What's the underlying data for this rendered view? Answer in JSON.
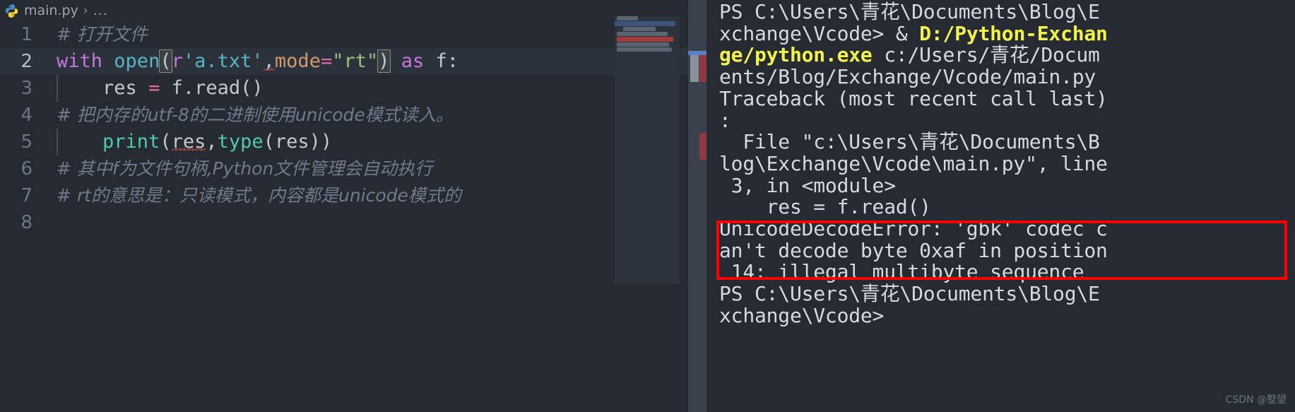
{
  "window": {
    "app": "vscode-editor-with-terminal"
  },
  "breadcrumb": {
    "file_icon": "python-file-icon",
    "file": "main.py",
    "separator": "›",
    "dots": "..."
  },
  "editor": {
    "active_line": 2,
    "gutter": [
      "1",
      "2",
      "3",
      "4",
      "5",
      "6",
      "7",
      "8"
    ],
    "lines": [
      {
        "number": "1",
        "type": "comment",
        "text": "# 打开文件"
      },
      {
        "number": "2",
        "type": "code",
        "tokens": [
          {
            "t": "with",
            "c": "keyword"
          },
          {
            "t": " ",
            "c": "plain"
          },
          {
            "t": "open",
            "c": "function"
          },
          {
            "t": "(",
            "c": "bracket-match"
          },
          {
            "t": "r",
            "c": "raw-prefix"
          },
          {
            "t": "'a.txt'",
            "c": "string"
          },
          {
            "t": ",",
            "c": "plain-squiggle"
          },
          {
            "t": "mode",
            "c": "param"
          },
          {
            "t": "=",
            "c": "operator"
          },
          {
            "t": "\"rt\"",
            "c": "string"
          },
          {
            "t": ")",
            "c": "bracket-match"
          },
          {
            "t": " ",
            "c": "plain"
          },
          {
            "t": "as",
            "c": "keyword"
          },
          {
            "t": " f:",
            "c": "plain"
          }
        ],
        "plain": "with open(r'a.txt',mode=\"rt\") as f:"
      },
      {
        "number": "3",
        "type": "code",
        "tokens": [
          {
            "t": "    ",
            "c": "plain"
          },
          {
            "t": "res",
            "c": "plain"
          },
          {
            "t": " ",
            "c": "plain"
          },
          {
            "t": "=",
            "c": "equals"
          },
          {
            "t": " ",
            "c": "plain"
          },
          {
            "t": "f.read()",
            "c": "plain"
          }
        ],
        "plain": "    res = f.read()"
      },
      {
        "number": "4",
        "type": "comment",
        "text": "# 把内存的utf-8的二进制使用unicode模式读入。"
      },
      {
        "number": "5",
        "type": "code",
        "tokens": [
          {
            "t": "    ",
            "c": "plain"
          },
          {
            "t": "print",
            "c": "builtin"
          },
          {
            "t": "(",
            "c": "plain"
          },
          {
            "t": "res",
            "c": "plain-squiggle"
          },
          {
            "t": ",",
            "c": "plain"
          },
          {
            "t": "type",
            "c": "builtin"
          },
          {
            "t": "(res))",
            "c": "plain"
          }
        ],
        "plain": "    print(res,type(res))"
      },
      {
        "number": "6",
        "type": "comment",
        "text": "# 其中f为文件句柄,Python文件管理会自动执行"
      },
      {
        "number": "7",
        "type": "comment",
        "text": "# rt的意思是：只读模式，内容都是unicode模式的"
      },
      {
        "number": "8",
        "type": "blank",
        "text": ""
      }
    ]
  },
  "terminal": {
    "lines": [
      [
        {
          "t": "PS C:\\Users\\青花\\Documents\\Blog\\E",
          "c": "normal"
        }
      ],
      [
        {
          "t": "xchange\\Vcode> & ",
          "c": "normal"
        },
        {
          "t": "D:/Python-Exchan",
          "c": "highlight"
        }
      ],
      [
        {
          "t": "ge/python.exe",
          "c": "highlight"
        },
        {
          "t": " c:/Users/青花/Docum",
          "c": "normal"
        }
      ],
      [
        {
          "t": "ents/Blog/Exchange/Vcode/main.py",
          "c": "normal"
        }
      ],
      [
        {
          "t": "Traceback (most recent call last)",
          "c": "normal"
        }
      ],
      [
        {
          "t": ":",
          "c": "normal"
        }
      ],
      [
        {
          "t": "  File \"c:\\Users\\青花\\Documents\\B",
          "c": "normal"
        }
      ],
      [
        {
          "t": "log\\Exchange\\Vcode\\main.py\", line",
          "c": "normal"
        }
      ],
      [
        {
          "t": " 3, in <module>",
          "c": "normal"
        }
      ],
      [
        {
          "t": "    res = f.read()",
          "c": "normal"
        }
      ],
      [
        {
          "t": "UnicodeDecodeError: 'gbk' codec c",
          "c": "normal"
        }
      ],
      [
        {
          "t": "an't decode byte 0xaf in position",
          "c": "normal"
        }
      ],
      [
        {
          "t": " 14: illegal multibyte sequence",
          "c": "normal"
        }
      ],
      [
        {
          "t": "PS C:\\Users\\青花\\Documents\\Blog\\E",
          "c": "normal"
        }
      ],
      [
        {
          "t": "xchange\\Vcode>",
          "c": "normal"
        }
      ]
    ],
    "error_highlight": {
      "color": "#ff0000",
      "start_line_index": 10,
      "end_line_index": 12
    }
  },
  "watermark": {
    "text": "CSDN @墅望"
  },
  "colors": {
    "editor_bg": "#262b33",
    "active_line_bg": "#2c323c",
    "terminal_bg": "#262b33",
    "accent_yellow": "#f2f24a",
    "error_red": "#ff0000",
    "line_number": "#6b7585",
    "comment": "#707a8a"
  }
}
